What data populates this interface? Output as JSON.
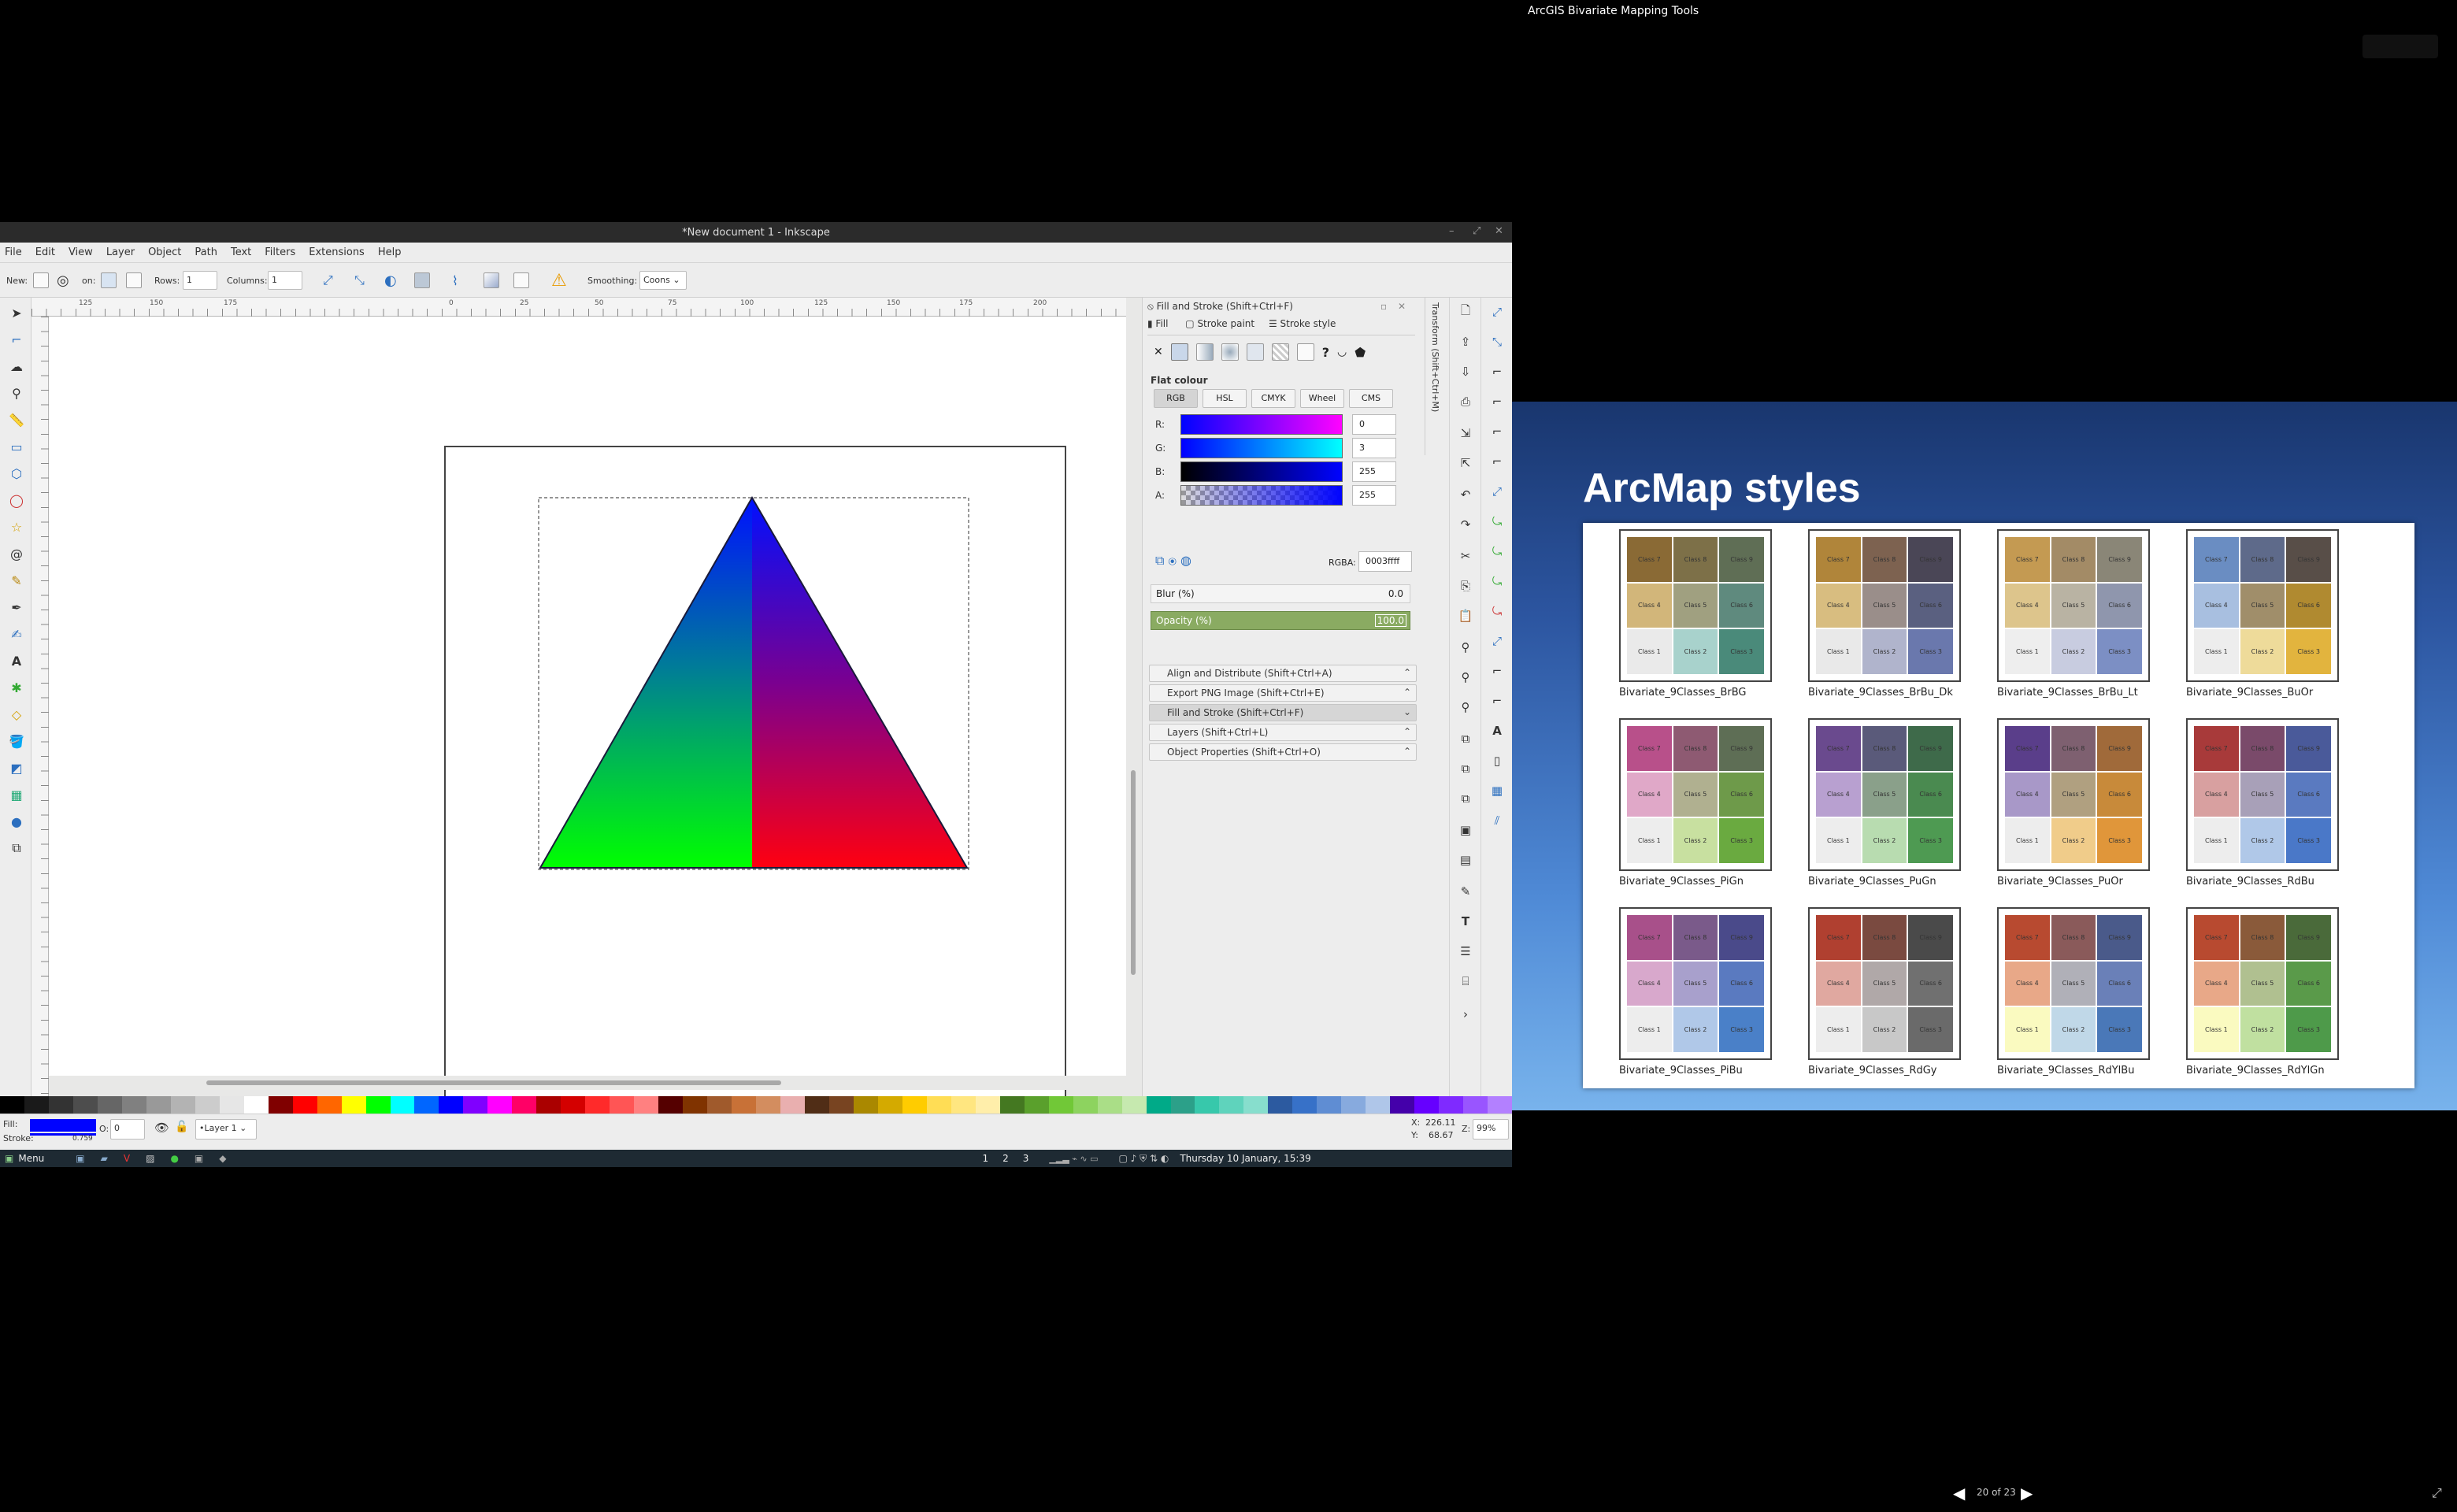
{
  "inkscape": {
    "window_title": "*New document 1 - Inkscape",
    "menu": [
      "File",
      "Edit",
      "View",
      "Layer",
      "Object",
      "Path",
      "Text",
      "Filters",
      "Extensions",
      "Help"
    ],
    "toolbar": {
      "new_label": "New:",
      "on_label": "on:",
      "rows_label": "Rows:",
      "rows_value": "1",
      "columns_label": "Columns:",
      "columns_value": "1",
      "smoothing_label": "Smoothing:",
      "smoothing_value": "Coons"
    },
    "ruler_ticks": [
      "125",
      "150",
      "175",
      "0",
      "25",
      "50",
      "75",
      "100",
      "125",
      "150",
      "175",
      "200"
    ],
    "dock": {
      "title": "Fill and Stroke (Shift+Ctrl+F)",
      "tabs": [
        "Fill",
        "Stroke paint",
        "Stroke style"
      ],
      "flat_colour": "Flat colour",
      "modes": [
        "RGB",
        "HSL",
        "CMYK",
        "Wheel",
        "CMS"
      ],
      "channels": [
        {
          "label": "R:",
          "value": "0"
        },
        {
          "label": "G:",
          "value": "3"
        },
        {
          "label": "B:",
          "value": "255"
        },
        {
          "label": "A:",
          "value": "255"
        }
      ],
      "rgba_label": "RGBA:",
      "rgba_value": "0003ffff",
      "blur_label": "Blur (%)",
      "blur_value": "0.0",
      "opacity_label": "Opacity (%)",
      "opacity_value": "100.0",
      "side_tab": "Transform (Shift+Ctrl+M)",
      "panels": [
        "Align and Distribute (Shift+Ctrl+A)",
        "Export PNG Image (Shift+Ctrl+E)",
        "Fill and Stroke (Shift+Ctrl+F)",
        "Layers (Shift+Ctrl+L)",
        "Object Properties (Shift+Ctrl+O)"
      ]
    },
    "status": {
      "fill_label": "Fill:",
      "stroke_label": "Stroke:",
      "stroke_width": "0.759",
      "opacity_label": "O:",
      "opacity_value": "0",
      "layer": "•Layer 1",
      "x_label": "X:",
      "x_value": "226.11",
      "y_label": "Y:",
      "y_value": "68.67",
      "zoom_label": "Z:",
      "zoom_value": "99%"
    },
    "taskbar": {
      "menu": "Menu",
      "workspaces": [
        "1",
        "2",
        "3"
      ],
      "clock": "Thursday 10 January, 15:39"
    },
    "palette": [
      "#000000",
      "#1a1a1a",
      "#333333",
      "#4d4d4d",
      "#666666",
      "#808080",
      "#999999",
      "#b3b3b3",
      "#cccccc",
      "#e6e6e6",
      "#ffffff",
      "#800000",
      "#ff0000",
      "#ff6600",
      "#ffff00",
      "#00ff00",
      "#00ffff",
      "#0066ff",
      "#0000ff",
      "#8000ff",
      "#ff00ff",
      "#ff0066",
      "#aa0000",
      "#d40000",
      "#ff2a2a",
      "#ff5555",
      "#ff8080",
      "#550000",
      "#803300",
      "#a05a2c",
      "#c87137",
      "#d38d5f",
      "#e9afaf",
      "#502d16",
      "#784421",
      "#aa8800",
      "#d4aa00",
      "#ffcc00",
      "#ffdd55",
      "#ffe680",
      "#ffeeaa",
      "#447821",
      "#5aa02c",
      "#71c837",
      "#8dd35f",
      "#aade87",
      "#c6e9af",
      "#00aa88",
      "#2ca089",
      "#37c8ab",
      "#5fd3bc",
      "#87decd",
      "#2c5aa0",
      "#3771c8",
      "#5f8dd3",
      "#87aade",
      "#afc6e9",
      "#4400aa",
      "#6600ff",
      "#7f2aff",
      "#9955ff",
      "#b380ff"
    ]
  },
  "slides": {
    "window_title": "ArcGIS Bivariate Mapping Tools",
    "heading": "ArcMap styles",
    "page_counter": "20 of 23",
    "maps": [
      {
        "name": "Bivariate_9Classes_BrBG",
        "colors": [
          "#8a6a35",
          "#7d7048",
          "#5f6e55",
          "#d2b67a",
          "#a0a080",
          "#5f8a7e",
          "#eaeaea",
          "#a8d2cc",
          "#4a8a7a"
        ]
      },
      {
        "name": "Bivariate_9Classes_BrBu_Dk",
        "colors": [
          "#b0853a",
          "#7d6250",
          "#4a4656",
          "#d8bd80",
          "#9a8e8a",
          "#5a6080",
          "#e9e9e9",
          "#b0b4cc",
          "#6a78ad"
        ]
      },
      {
        "name": "Bivariate_9Classes_BrBu_Lt",
        "colors": [
          "#c49a52",
          "#a38b66",
          "#8a8677",
          "#ddc58c",
          "#b9b3a3",
          "#8f96ad",
          "#eeeeee",
          "#c8cce0",
          "#7c8fc4"
        ]
      },
      {
        "name": "Bivariate_9Classes_BuOr",
        "colors": [
          "#6a8dc2",
          "#5e6a8a",
          "#584e48",
          "#a8bfe0",
          "#a08e6a",
          "#b08a30",
          "#ededed",
          "#eedb9a",
          "#e2b43e"
        ]
      },
      {
        "name": "Bivariate_9Classes_PiGn",
        "colors": [
          "#b8508a",
          "#8e5a72",
          "#5e6e55",
          "#e0a8c8",
          "#b0b090",
          "#6e9a4a",
          "#ededed",
          "#c8e0a0",
          "#6aaa40"
        ]
      },
      {
        "name": "Bivariate_9Classes_PuGn",
        "colors": [
          "#6a4a8e",
          "#5a5a7a",
          "#3e6a4a",
          "#b8a0d0",
          "#8aa08a",
          "#4a8a50",
          "#ededed",
          "#b8dcb0",
          "#4e9a52"
        ]
      },
      {
        "name": "Bivariate_9Classes_PuOr",
        "colors": [
          "#5a3e8a",
          "#7e6070",
          "#a06a3a",
          "#a898c8",
          "#b0a080",
          "#c88a3a",
          "#ededed",
          "#f0cc8a",
          "#e0963a"
        ]
      },
      {
        "name": "Bivariate_9Classes_RdBu",
        "colors": [
          "#a83a3a",
          "#7a4a6a",
          "#4a5a9a",
          "#d8a0a0",
          "#a8a0b8",
          "#5a7ac0",
          "#ededed",
          "#b0c8e8",
          "#4a78c8"
        ]
      },
      {
        "name": "Bivariate_9Classes_PiBu",
        "colors": [
          "#a8508a",
          "#7a5a8a",
          "#4a4a8a",
          "#d8a8cc",
          "#a8a0cc",
          "#5a7ac0",
          "#ededed",
          "#b0c8e8",
          "#4a80c8"
        ]
      },
      {
        "name": "Bivariate_9Classes_RdGy",
        "colors": [
          "#b04030",
          "#7a4a40",
          "#4a4a4a",
          "#e0a8a0",
          "#b0a8a8",
          "#707070",
          "#ededed",
          "#c8c8c8",
          "#6a6a6a"
        ]
      },
      {
        "name": "Bivariate_9Classes_RdYlBu",
        "colors": [
          "#b84a30",
          "#8a5a5a",
          "#4a5a8a",
          "#e8a888",
          "#b0b0b8",
          "#6a80b8",
          "#fafac0",
          "#c0d8e8",
          "#4a78b8"
        ]
      },
      {
        "name": "Bivariate_9Classes_RdYlGn",
        "colors": [
          "#b84a30",
          "#8a5a3a",
          "#4a6a3a",
          "#e8a888",
          "#b0c090",
          "#5a9a4a",
          "#fafac0",
          "#c0e0a0",
          "#4e9a4a"
        ]
      }
    ],
    "class_labels": [
      "Class 7",
      "Class 8",
      "Class 9",
      "Class 4",
      "Class 5",
      "Class 6",
      "Class 1",
      "Class 2",
      "Class 3"
    ]
  }
}
